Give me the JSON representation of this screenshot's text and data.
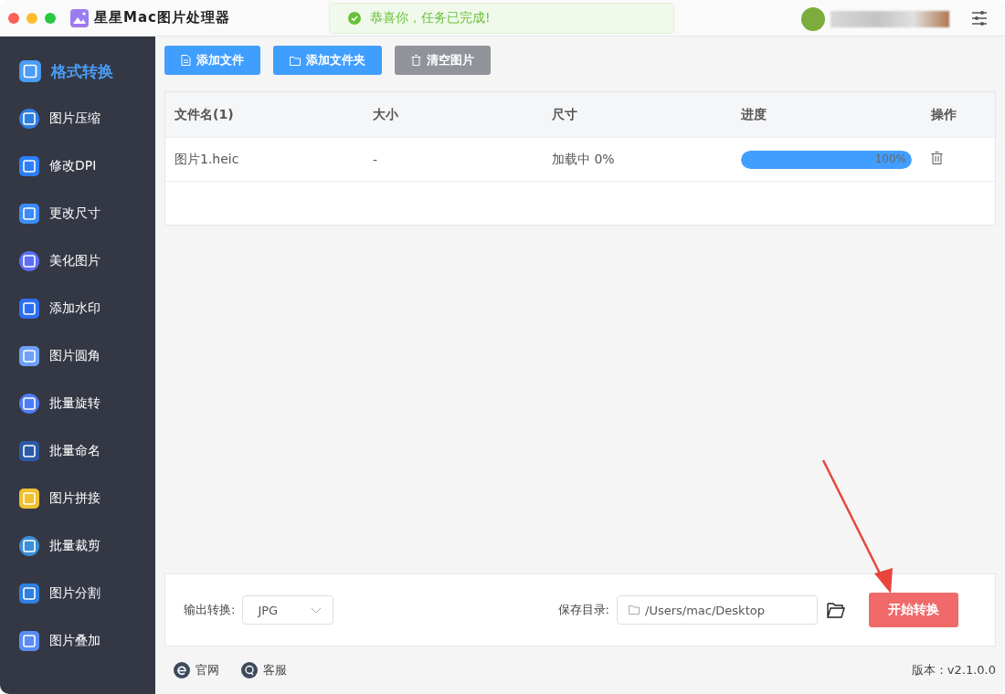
{
  "window": {
    "title": "星星Mac图片处理器"
  },
  "toast": {
    "message": "恭喜你，任务已完成!"
  },
  "sidebar": {
    "items": [
      {
        "label": "格式转换",
        "selected": true
      },
      {
        "label": "图片压缩",
        "selected": false
      },
      {
        "label": "修改DPI",
        "selected": false
      },
      {
        "label": "更改尺寸",
        "selected": false
      },
      {
        "label": "美化图片",
        "selected": false
      },
      {
        "label": "添加水印",
        "selected": false
      },
      {
        "label": "图片圆角",
        "selected": false
      },
      {
        "label": "批量旋转",
        "selected": false
      },
      {
        "label": "批量命名",
        "selected": false
      },
      {
        "label": "图片拼接",
        "selected": false
      },
      {
        "label": "批量裁剪",
        "selected": false
      },
      {
        "label": "图片分割",
        "selected": false
      },
      {
        "label": "图片叠加",
        "selected": false
      }
    ]
  },
  "toolbar": [
    {
      "label": "添加文件",
      "kind": "file"
    },
    {
      "label": "添加文件夹",
      "kind": "folder"
    },
    {
      "label": "清空图片",
      "kind": "clear"
    }
  ],
  "table": {
    "columns": [
      "文件名(1)",
      "大小",
      "尺寸",
      "进度",
      "操作"
    ],
    "rows": [
      {
        "name": "图片1.heic",
        "size": "-",
        "dimensions": "加载中 0%",
        "level": 1,
        "reading": "100%"
      }
    ]
  },
  "output": {
    "label": "输出转换:",
    "format": "JPG",
    "save_label": "保存目录:",
    "save_path": "/Users/mac/Desktop",
    "start": "开始转换"
  },
  "footer": {
    "links": [
      "官网",
      "客服"
    ],
    "version": "版本：v2.1.0.0"
  }
}
